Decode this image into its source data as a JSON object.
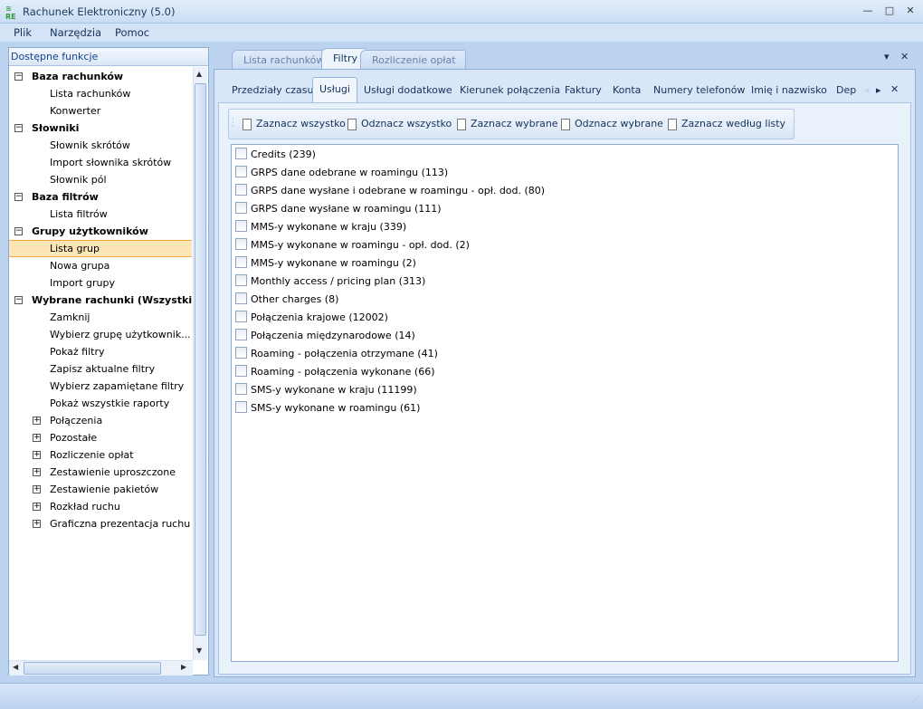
{
  "window": {
    "title": "Rachunek Elektroniczny (5.0)",
    "logo": "RE",
    "minimize": "—",
    "maximize": "□",
    "close": "✕"
  },
  "menu": [
    "Plik",
    "Narzędzia",
    "Pomoc"
  ],
  "sidebar": {
    "title": "Dostępne funkcje",
    "items": [
      {
        "label": "Baza rachunków",
        "level": 0,
        "toggle": "−"
      },
      {
        "label": "Lista rachunków",
        "level": 1
      },
      {
        "label": "Konwerter",
        "level": 1
      },
      {
        "label": "Słowniki",
        "level": 0,
        "toggle": "−"
      },
      {
        "label": "Słownik skrótów",
        "level": 1
      },
      {
        "label": "Import słownika skrótów",
        "level": 1
      },
      {
        "label": "Słownik pól",
        "level": 1
      },
      {
        "label": "Baza filtrów",
        "level": 0,
        "toggle": "−"
      },
      {
        "label": "Lista filtrów",
        "level": 1
      },
      {
        "label": "Grupy użytkowników",
        "level": 0,
        "toggle": "−"
      },
      {
        "label": "Lista grup",
        "level": 1,
        "selected": true
      },
      {
        "label": "Nowa grupa",
        "level": 1
      },
      {
        "label": "Import grupy",
        "level": 1
      },
      {
        "label": "Wybrane rachunki  (Wszystkie...",
        "level": 0,
        "toggle": "−"
      },
      {
        "label": "Zamknij",
        "level": 1
      },
      {
        "label": "Wybierz  grupę  użytkownik...",
        "level": 1
      },
      {
        "label": "Pokaż filtry",
        "level": 1
      },
      {
        "label": "Zapisz aktualne filtry",
        "level": 1
      },
      {
        "label": "Wybierz zapamiętane filtry",
        "level": 1
      },
      {
        "label": "Pokaż wszystkie raporty",
        "level": 1
      },
      {
        "label": "Połączenia",
        "level": 1,
        "toggle": "+"
      },
      {
        "label": "Pozostałe",
        "level": 1,
        "toggle": "+"
      },
      {
        "label": "Rozliczenie opłat",
        "level": 1,
        "toggle": "+"
      },
      {
        "label": "Zestawienie uproszczone",
        "level": 1,
        "toggle": "+"
      },
      {
        "label": "Zestawienie pakietów",
        "level": 1,
        "toggle": "+"
      },
      {
        "label": "Rozkład ruchu",
        "level": 1,
        "toggle": "+"
      },
      {
        "label": "Graficzna prezentacja ruchu",
        "level": 1,
        "toggle": "+"
      }
    ]
  },
  "doc_tabs": [
    {
      "label": "Lista rachunków"
    },
    {
      "label": "Filtry",
      "active": true
    },
    {
      "label": "Rozliczenie opłat"
    }
  ],
  "doc_tab_controls": {
    "dropdown": "▾",
    "close": "✕"
  },
  "filter_tabs": [
    {
      "label": "Przedziały czasu"
    },
    {
      "label": "Usługi",
      "active": true
    },
    {
      "label": "Usługi dodatkowe"
    },
    {
      "label": "Kierunek połączenia"
    },
    {
      "label": "Faktury"
    },
    {
      "label": "Konta"
    },
    {
      "label": "Numery telefonów"
    },
    {
      "label": "Imię i nazwisko"
    },
    {
      "label": "Dep"
    }
  ],
  "filter_tab_controls": {
    "prev": "◂",
    "next": "▸",
    "close": "✕"
  },
  "toolbar": [
    "Zaznacz wszystko",
    "Odznacz wszystko",
    "Zaznacz wybrane",
    "Odznacz wybrane",
    "Zaznacz według listy"
  ],
  "services": [
    {
      "label": "Credits (239)",
      "checked": false
    },
    {
      "label": "GRPS dane odebrane w roamingu (113)",
      "checked": false
    },
    {
      "label": "GRPS dane wysłane i odebrane w roamingu - opł. dod. (80)",
      "checked": false
    },
    {
      "label": "GRPS dane wysłane w roamingu (111)",
      "checked": false
    },
    {
      "label": "MMS-y wykonane w kraju (339)",
      "checked": false
    },
    {
      "label": "MMS-y wykonane w roamingu - opł. dod. (2)",
      "checked": false
    },
    {
      "label": "MMS-y wykonane w roamingu  (2)",
      "checked": false
    },
    {
      "label": "Monthly access / pricing plan (313)",
      "checked": false
    },
    {
      "label": "Other charges (8)",
      "checked": false
    },
    {
      "label": "Połączenia krajowe (12002)",
      "checked": false
    },
    {
      "label": "Połączenia międzynarodowe (14)",
      "checked": false
    },
    {
      "label": "Roaming - połączenia otrzymane (41)",
      "checked": false
    },
    {
      "label": "Roaming - połączenia wykonane (66)",
      "checked": false
    },
    {
      "label": "SMS-y wykonane w kraju (11199)",
      "checked": false
    },
    {
      "label": "SMS-y wykonane w roamingu (61)",
      "checked": false
    }
  ]
}
